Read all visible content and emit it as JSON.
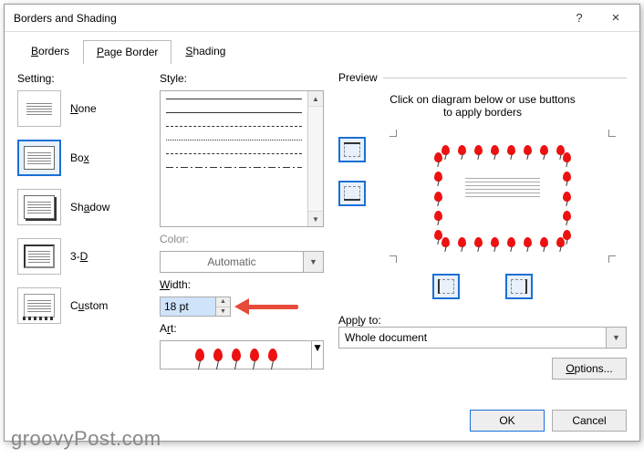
{
  "window": {
    "title": "Borders and Shading",
    "help": "?",
    "close": "×"
  },
  "tabs": {
    "borders": {
      "pre": "",
      "acc": "B",
      "post": "orders"
    },
    "pageborder": {
      "pre": "",
      "acc": "P",
      "post": "age Border"
    },
    "shading": {
      "pre": "",
      "acc": "S",
      "post": "hading"
    },
    "active": "pageborder"
  },
  "setting": {
    "label": "Setting:",
    "none": {
      "acc": "N",
      "post": "one"
    },
    "box": {
      "pre": "Bo",
      "acc": "x",
      "post": ""
    },
    "shadow": {
      "pre": "Sh",
      "acc": "a",
      "post": "dow"
    },
    "threeD": {
      "pre": "3-",
      "acc": "D",
      "post": ""
    },
    "custom": {
      "pre": "C",
      "acc": "u",
      "post": "stom"
    }
  },
  "style": {
    "style_label": "Style:",
    "color_label": "Color:",
    "color_value": "Automatic",
    "width_label": "Width:",
    "width_value": "18 pt",
    "art_label": "Art:"
  },
  "preview": {
    "legend": "Preview",
    "hint_line1": "Click on diagram below or use buttons",
    "hint_line2": "to apply borders",
    "apply_label": "Apply to:",
    "apply_value": "Whole document",
    "options": "Options..."
  },
  "buttons": {
    "ok": "OK",
    "cancel": "Cancel"
  },
  "watermark": "groovyPost.com"
}
